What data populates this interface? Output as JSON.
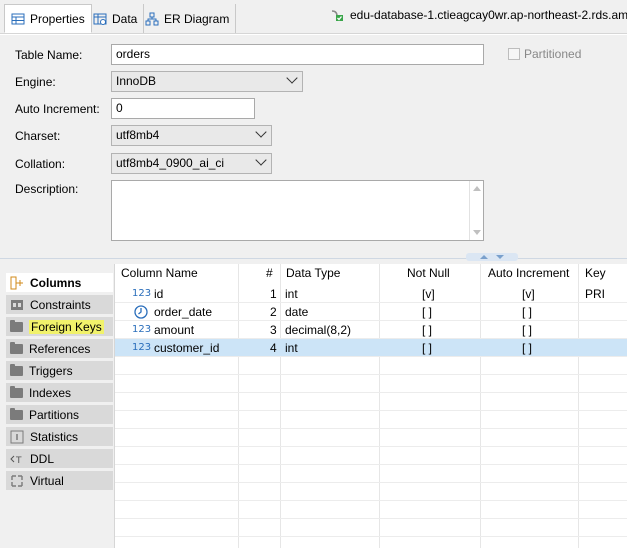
{
  "tabs": [
    {
      "label": "Properties",
      "icon": "properties-table-icon",
      "active": true
    },
    {
      "label": "Data",
      "icon": "data-grid-icon",
      "active": false
    },
    {
      "label": "ER Diagram",
      "icon": "er-diagram-icon",
      "active": false
    }
  ],
  "connection": {
    "label": "edu-database-1.ctieagcay0wr.ap-northeast-2.rds.am",
    "icon": "connection-icon"
  },
  "form": {
    "table_name_label": "Table Name:",
    "table_name": "orders",
    "partitioned_label": "Partitioned",
    "partitioned": false,
    "engine_label": "Engine:",
    "engine": "InnoDB",
    "auto_increment_label": "Auto Increment:",
    "auto_increment": "0",
    "charset_label": "Charset:",
    "charset": "utf8mb4",
    "collation_label": "Collation:",
    "collation": "utf8mb4_0900_ai_ci",
    "description_label": "Description:",
    "description": ""
  },
  "sidenav": [
    {
      "label": "Columns",
      "icon": "columns-icon",
      "active": true,
      "highlight": false
    },
    {
      "label": "Constraints",
      "icon": "constraints-icon",
      "active": false,
      "highlight": false
    },
    {
      "label": "Foreign Keys",
      "icon": "folder-icon",
      "active": false,
      "highlight": true
    },
    {
      "label": "References",
      "icon": "folder-icon",
      "active": false,
      "highlight": false
    },
    {
      "label": "Triggers",
      "icon": "folder-icon",
      "active": false,
      "highlight": false
    },
    {
      "label": "Indexes",
      "icon": "folder-icon",
      "active": false,
      "highlight": false
    },
    {
      "label": "Partitions",
      "icon": "folder-icon",
      "active": false,
      "highlight": false
    },
    {
      "label": "Statistics",
      "icon": "statistics-icon",
      "active": false,
      "highlight": false
    },
    {
      "label": "DDL",
      "icon": "ddl-icon",
      "active": false,
      "highlight": false
    },
    {
      "label": "Virtual",
      "icon": "virtual-icon",
      "active": false,
      "highlight": false
    }
  ],
  "columns_table": {
    "headers": {
      "name": "Column Name",
      "num": "#",
      "type": "Data Type",
      "not_null": "Not Null",
      "auto_inc": "Auto Increment",
      "key": "Key"
    },
    "rows": [
      {
        "name": "id",
        "num": "1",
        "type": "int",
        "not_null": "[v]",
        "auto_inc": "[v]",
        "key": "PRI",
        "icon": "numeric-key-icon",
        "selected": false
      },
      {
        "name": "order_date",
        "num": "2",
        "type": "date",
        "not_null": "[ ]",
        "auto_inc": "[ ]",
        "key": "",
        "icon": "clock-icon",
        "selected": false
      },
      {
        "name": "amount",
        "num": "3",
        "type": "decimal(8,2)",
        "not_null": "[ ]",
        "auto_inc": "[ ]",
        "key": "",
        "icon": "numeric-icon",
        "selected": false
      },
      {
        "name": "customer_id",
        "num": "4",
        "type": "int",
        "not_null": "[ ]",
        "auto_inc": "[ ]",
        "key": "",
        "icon": "numeric-icon",
        "selected": true
      }
    ]
  },
  "colors": {
    "accent": "#2a6ebb",
    "selection": "#cce4f7",
    "highlight": "#f1f26b"
  }
}
